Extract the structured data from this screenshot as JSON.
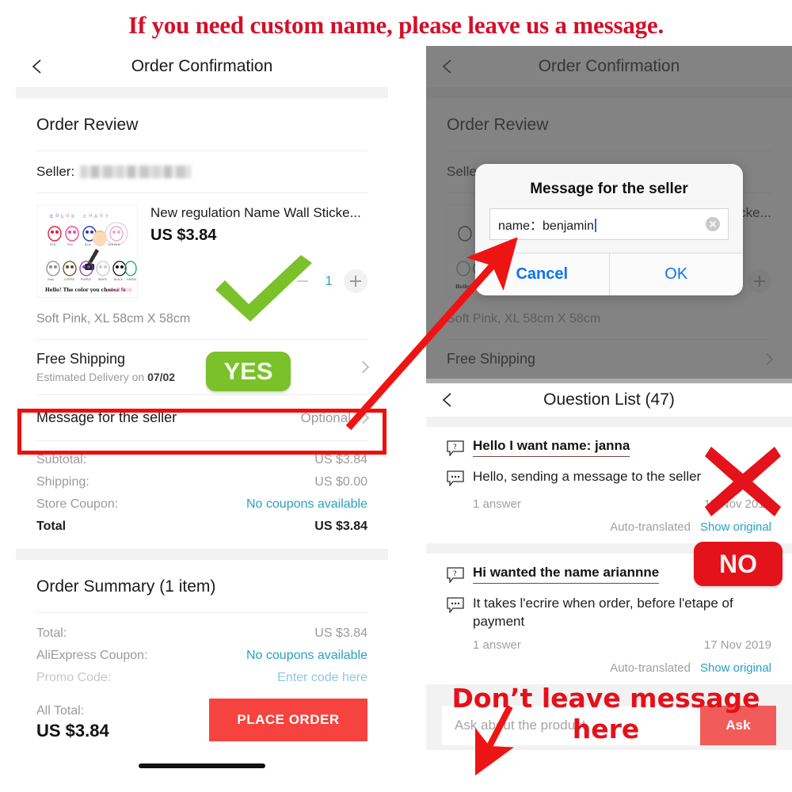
{
  "banner": {
    "text": "If you need custom name, please leave us a message."
  },
  "left_phone": {
    "nav": {
      "title": "Order Confirmation",
      "back_icon": "chevron-left-icon"
    },
    "order_review": {
      "heading": "Order Review",
      "seller_label": "Seller:",
      "seller_value_redacted": true,
      "product": {
        "title": "New regulation Name Wall Sticke...",
        "price": "US $3.84",
        "variant": "Soft Pink, XL 58cm X 58cm",
        "quantity": "1",
        "thumb_caption": "Hello! The color you choose is Soft Pink",
        "thumb_heading": "COLOR CHART",
        "thumb_swatches": [
          "RED",
          "Pink",
          "Blue",
          "Soft Pink",
          "Gray",
          "Coffee",
          "Purple",
          "White",
          "Black",
          "Green"
        ]
      },
      "shipping": {
        "title": "Free Shipping",
        "estimate_prefix": "Estimated Delivery on ",
        "estimate_date": "07/02"
      },
      "message_row": {
        "label": "Message for the seller",
        "value": "Optional"
      },
      "totals": [
        {
          "key": "Subtotal:",
          "value": "US $3.84",
          "link": false
        },
        {
          "key": "Shipping:",
          "value": "US $0.00",
          "link": false
        },
        {
          "key": "Store Coupon:",
          "value": "No coupons available",
          "link": true
        }
      ],
      "total_row": {
        "key": "Total",
        "value": "US $3.84"
      }
    },
    "order_summary": {
      "heading": "Order Summary (1 item)",
      "rows": [
        {
          "key": "Total:",
          "value": "US $3.84",
          "link": false
        },
        {
          "key": "AliExpress Coupon:",
          "value": "No coupons available",
          "link": true
        },
        {
          "key": "Promo Code:",
          "value": "Enter code here",
          "link": true
        }
      ],
      "all_total_label": "All Total:",
      "all_total_value": "US $3.84",
      "place_order_label": "PLACE ORDER"
    }
  },
  "right_phone": {
    "nav": {
      "title": "Order Confirmation",
      "back_icon": "chevron-left-icon"
    },
    "order_review_heading": "Order Review",
    "seller_label": "Seller",
    "variant": "Soft Pink, XL 58cm X 58cm",
    "shipping_title": "Free Shipping",
    "dialog": {
      "title": "Message for the seller",
      "input_value": "name：benjamin",
      "clear_icon": "clear-circle-icon",
      "cancel_label": "Cancel",
      "ok_label": "OK"
    }
  },
  "question_list": {
    "nav": {
      "title": "Ouestion List (47)",
      "back_icon": "chevron-left-icon"
    },
    "items": [
      {
        "question": "Hello I want name: janna",
        "answer": "Hello, sending a message to the seller",
        "answer_count": "1 answer",
        "date": "17 Nov 2019",
        "auto_translated": "Auto-translated",
        "show_original": "Show original"
      },
      {
        "question": "Hi wanted the name ariannne",
        "answer": "It takes l'ecrire when order, before l'etape of payment",
        "answer_count": "1 answer",
        "date": "17 Nov 2019",
        "auto_translated": "Auto-translated",
        "show_original": "Show original"
      }
    ],
    "ask_placeholder": "Ask about the product.",
    "ask_button": "Ask"
  },
  "annotations": {
    "yes_badge": "YES",
    "no_badge": "NO",
    "dont_leave_text": "Don’t leave  message here",
    "highlight_box_target": "Message for the seller",
    "check_icon": "green-check-icon",
    "cross_icon": "red-x-icon",
    "arrow_icon": "red-arrow-icon"
  },
  "colors": {
    "banner_red": "#d40f28",
    "annotation_red": "#f20d0d",
    "badge_green": "#7ac12a",
    "badge_red": "#e4121a",
    "place_order_red": "#f6433f",
    "ask_red": "#f15c5a",
    "link_blue": "#2aa0c4",
    "ios_blue": "#0a74f0",
    "qty_teal": "#25a5b5"
  }
}
